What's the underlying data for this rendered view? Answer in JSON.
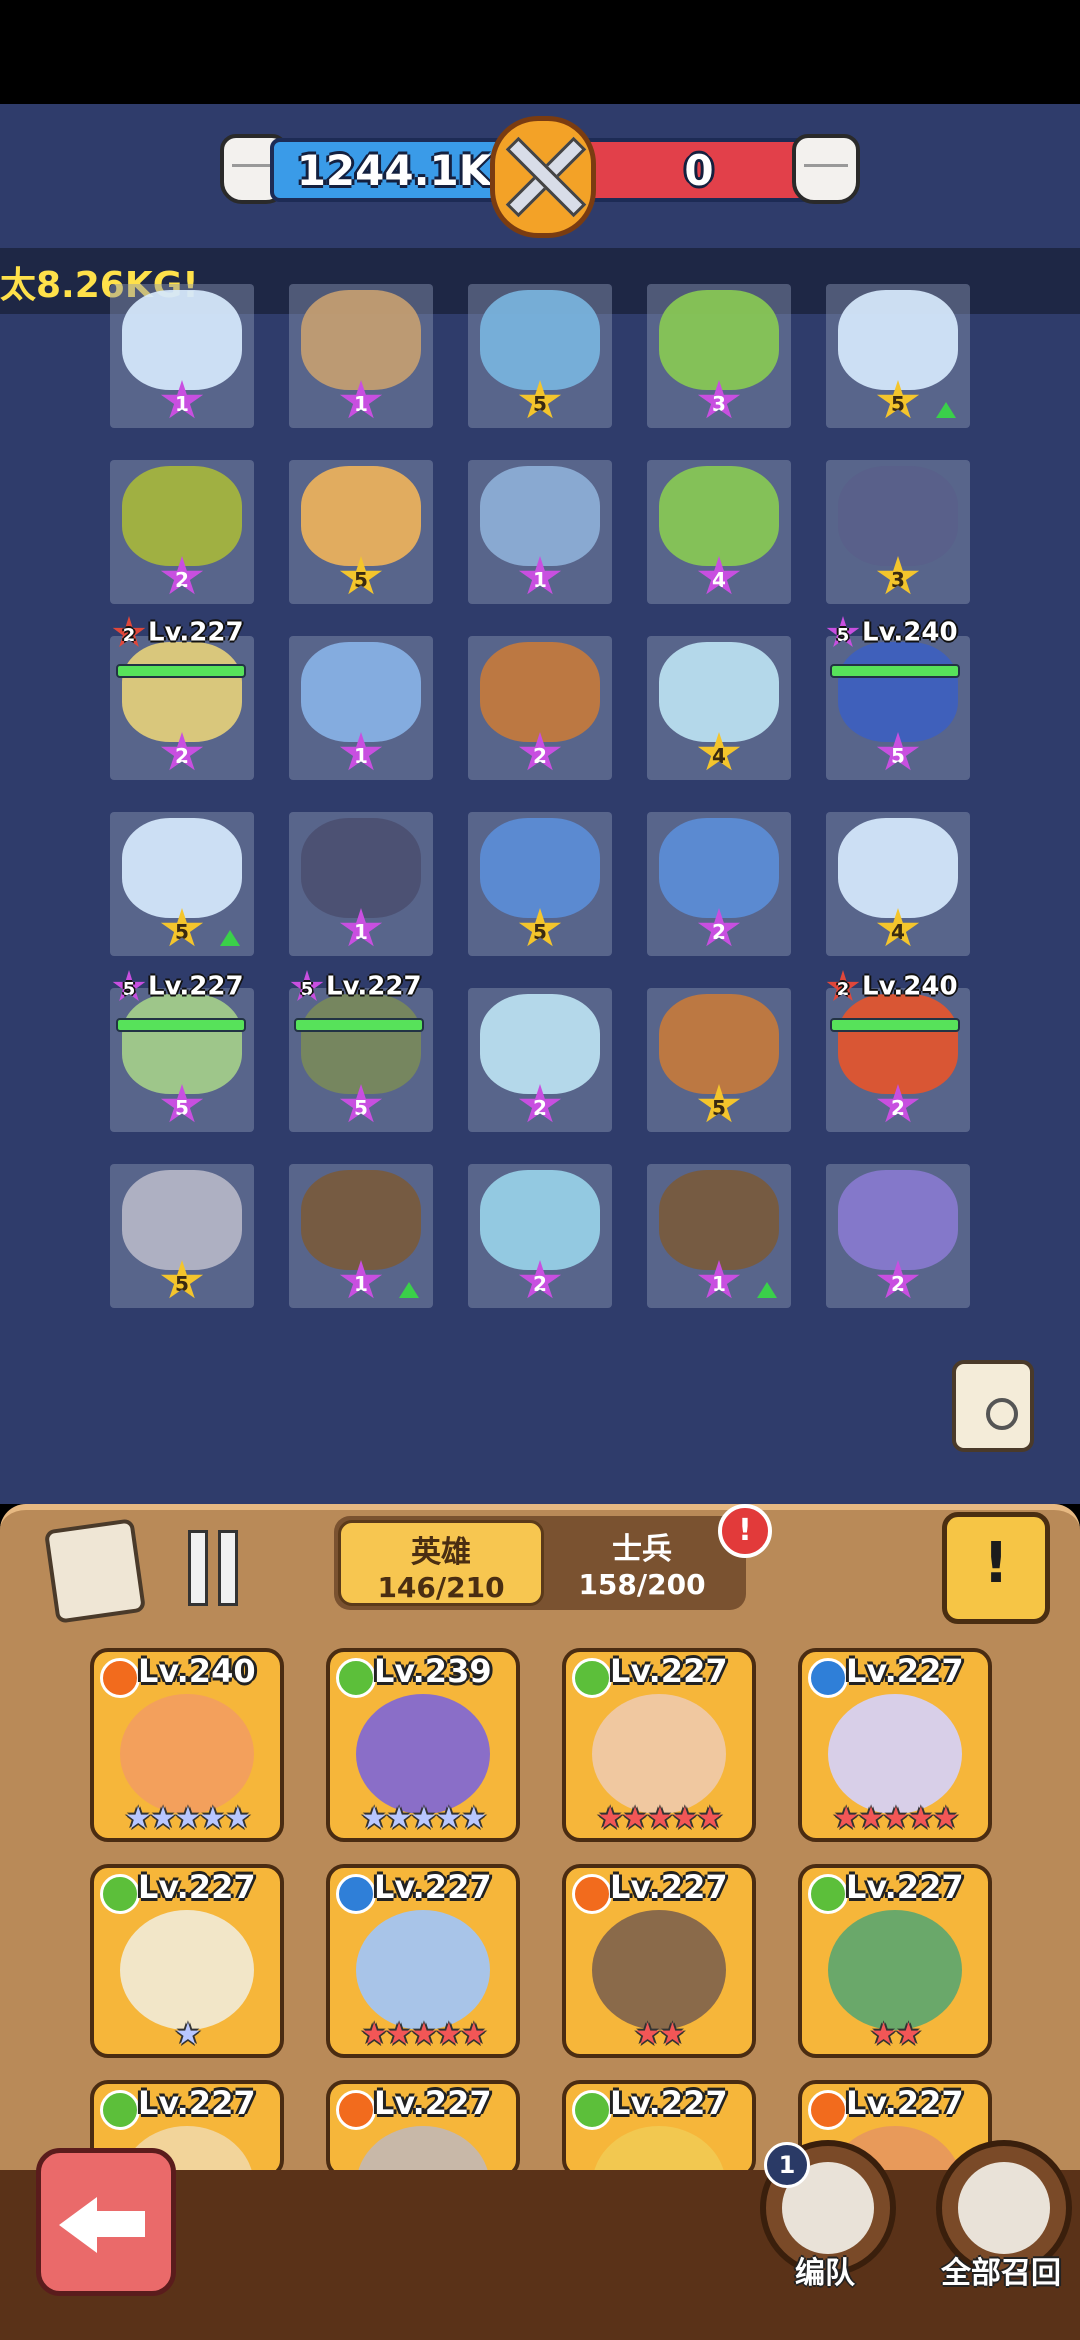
{
  "power": {
    "left_value": "1244.1K",
    "right_value": "0"
  },
  "banner_text": "太8.26KG!",
  "grid": {
    "cells": [
      {
        "stars": "1",
        "star_color": "purple",
        "unit_color": "#d9ecff"
      },
      {
        "stars": "1",
        "star_color": "purple",
        "unit_color": "#c8a070"
      },
      {
        "stars": "5",
        "star_color": "gold",
        "unit_color": "#7ab6e0"
      },
      {
        "stars": "3",
        "star_color": "purple",
        "unit_color": "#8acb52"
      },
      {
        "stars": "5",
        "star_color": "gold",
        "unit_color": "#d9ecff",
        "up": true
      },
      {
        "stars": "2",
        "star_color": "purple",
        "unit_color": "#a8b83a"
      },
      {
        "stars": "5",
        "star_color": "gold",
        "unit_color": "#f1b45a"
      },
      {
        "stars": "1",
        "star_color": "purple",
        "unit_color": "#8fb0d8"
      },
      {
        "stars": "4",
        "star_color": "purple",
        "unit_color": "#8acb52"
      },
      {
        "stars": "3",
        "star_color": "gold",
        "unit_color": "#5a5f8a"
      },
      {
        "stars": "2",
        "star_color": "purple",
        "unit_color": "#e8d27a"
      },
      {
        "stars": "1",
        "star_color": "purple",
        "unit_color": "#8ab4e8"
      },
      {
        "stars": "2",
        "star_color": "purple",
        "unit_color": "#c87a3a"
      },
      {
        "stars": "4",
        "star_color": "gold",
        "unit_color": "#bfe4f4"
      },
      {
        "stars": "5",
        "star_color": "purple",
        "unit_color": "#3d5fc0"
      },
      {
        "stars": "5",
        "star_color": "gold",
        "unit_color": "#d9ecff",
        "up": true
      },
      {
        "stars": "1",
        "star_color": "purple",
        "unit_color": "#4b4f70"
      },
      {
        "stars": "5",
        "star_color": "gold",
        "unit_color": "#5c8ed8"
      },
      {
        "stars": "2",
        "star_color": "purple",
        "unit_color": "#5c8ed8"
      },
      {
        "stars": "4",
        "star_color": "gold",
        "unit_color": "#d9ecff"
      },
      {
        "stars": "5",
        "star_color": "purple",
        "unit_color": "#a6d08a"
      },
      {
        "stars": "5",
        "star_color": "purple",
        "unit_color": "#7a8a5a"
      },
      {
        "stars": "2",
        "star_color": "purple",
        "unit_color": "#bfe4f4"
      },
      {
        "stars": "5",
        "star_color": "gold",
        "unit_color": "#c87a3a"
      },
      {
        "stars": "2",
        "star_color": "purple",
        "unit_color": "#e8542a"
      },
      {
        "stars": "5",
        "star_color": "gold",
        "unit_color": "#b8b8c8"
      },
      {
        "stars": "1",
        "star_color": "purple",
        "unit_color": "#7a5a3a",
        "up": true
      },
      {
        "stars": "2",
        "star_color": "purple",
        "unit_color": "#9ad4ea"
      },
      {
        "stars": "1",
        "star_color": "purple",
        "unit_color": "#7a5a3a",
        "up": true
      },
      {
        "stars": "2",
        "star_color": "purple",
        "unit_color": "#8a7ad0"
      }
    ],
    "hero_tags": [
      {
        "mini": "2",
        "mini_color": "r",
        "label": "Lv.227"
      },
      {
        "mini": "5",
        "mini_color": "p",
        "label": "Lv.240"
      },
      {
        "mini": "5",
        "mini_color": "p",
        "label": "Lv.227"
      },
      {
        "mini": "5",
        "mini_color": "p",
        "label": "Lv.227"
      },
      {
        "mini": "2",
        "mini_color": "r",
        "label": "Lv.240"
      }
    ]
  },
  "tabs": {
    "heroes": {
      "label": "英雄",
      "count": "146/210"
    },
    "soldiers": {
      "label": "士兵",
      "count": "158/200"
    },
    "alert": "!"
  },
  "info_label": "!",
  "heroes": [
    {
      "level": "Lv.240",
      "element": "fire",
      "stars": "★★★★★",
      "star_color": "blue",
      "face": "#f3a05c"
    },
    {
      "level": "Lv.239",
      "element": "leaf",
      "stars": "★★★★★",
      "star_color": "blue",
      "face": "#8a6ec8"
    },
    {
      "level": "Lv.227",
      "element": "leaf",
      "stars": "★★★★★",
      "star_color": "red",
      "face": "#f0c8a0"
    },
    {
      "level": "Lv.227",
      "element": "water",
      "stars": "★★★★★",
      "star_color": "red",
      "face": "#d8cfe8"
    },
    {
      "level": "Lv.227",
      "element": "leaf",
      "stars": "★",
      "star_color": "blue",
      "face": "#f2e6c8"
    },
    {
      "level": "Lv.227",
      "element": "water",
      "stars": "★★★★★",
      "star_color": "red",
      "face": "#a8c4e8"
    },
    {
      "level": "Lv.227",
      "element": "fire",
      "stars": "★★",
      "star_color": "red",
      "face": "#8a6a4a"
    },
    {
      "level": "Lv.227",
      "element": "leaf",
      "stars": "★★",
      "star_color": "red",
      "face": "#6aa86a"
    },
    {
      "level": "Lv.227",
      "element": "leaf",
      "stars": "",
      "star_color": "red",
      "face": "#f2d49a"
    },
    {
      "level": "Lv.227",
      "element": "fire",
      "stars": "",
      "star_color": "red",
      "face": "#c8b8a8"
    },
    {
      "level": "Lv.227",
      "element": "leaf",
      "stars": "",
      "star_color": "red",
      "face": "#f2c850"
    },
    {
      "level": "Lv.227",
      "element": "fire",
      "stars": "",
      "star_color": "red",
      "face": "#e89a5a"
    }
  ],
  "bottom": {
    "formation_label": "编队",
    "formation_badge": "1",
    "recall_label": "全部召回"
  }
}
